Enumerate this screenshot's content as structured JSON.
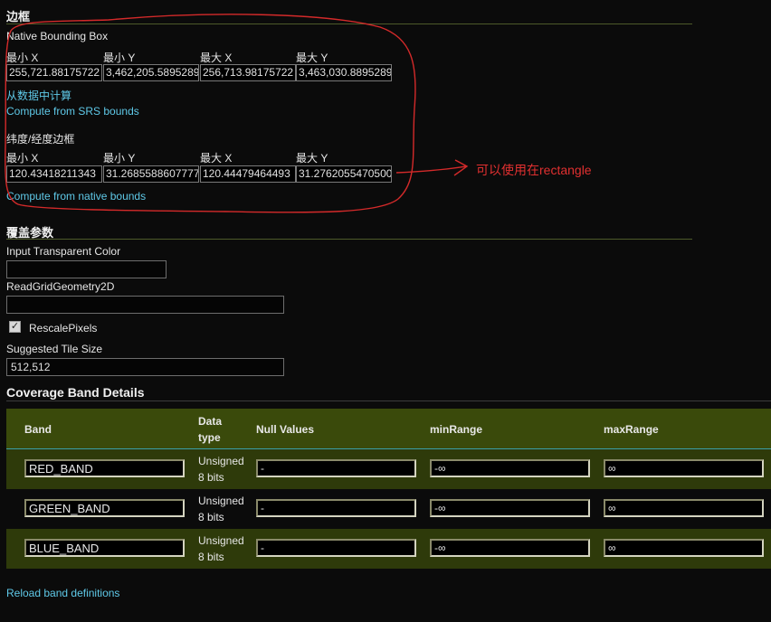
{
  "bbox": {
    "title": "边框",
    "native": {
      "label": "Native Bounding Box",
      "headers": [
        "最小 X",
        "最小 Y",
        "最大 X",
        "最大 Y"
      ],
      "values": [
        "255,721.88175722",
        "3,462,205.5895289",
        "256,713.98175722",
        "3,463,030.8895289"
      ],
      "compute_link": "从数据中计算",
      "srs_link": "Compute from SRS bounds"
    },
    "latlon": {
      "label": "纬度/经度边框",
      "headers": [
        "最小 X",
        "最小 Y",
        "最大 X",
        "最大 Y"
      ],
      "values": [
        "120.43418211343",
        "31.2685588607777",
        "120.44479464493",
        "31.2762055470500"
      ],
      "native_link": "Compute from native bounds"
    },
    "annotation": "可以使用在rectangle"
  },
  "coverage": {
    "title": "覆盖参数",
    "transparent_label": "Input Transparent Color",
    "transparent_value": "",
    "readgrid_label": "ReadGridGeometry2D",
    "readgrid_value": "",
    "rescale_label": "RescalePixels",
    "rescale_checked": true,
    "tile_label": "Suggested Tile Size",
    "tile_value": "512,512"
  },
  "bands": {
    "title": "Coverage Band Details",
    "headers": {
      "band": "Band",
      "dtype_line1": "Data",
      "dtype_line2": "type",
      "null": "Null Values",
      "min": "minRange",
      "max": "maxRange"
    },
    "rows": [
      {
        "band": "RED_BAND",
        "dtype1": "Unsigned",
        "dtype2": "8 bits",
        "null": "-",
        "min": "-∞",
        "max": "∞"
      },
      {
        "band": "GREEN_BAND",
        "dtype1": "Unsigned",
        "dtype2": "8 bits",
        "null": "-",
        "min": "-∞",
        "max": "∞"
      },
      {
        "band": "BLUE_BAND",
        "dtype1": "Unsigned",
        "dtype2": "8 bits",
        "null": "-",
        "min": "-∞",
        "max": "∞"
      }
    ],
    "reload_link": "Reload band definitions"
  },
  "colors": {
    "link": "#5fc9e8",
    "header_bg": "#3a4a0b",
    "row_bg": "#2e3a0a",
    "annotation": "#e03030"
  }
}
